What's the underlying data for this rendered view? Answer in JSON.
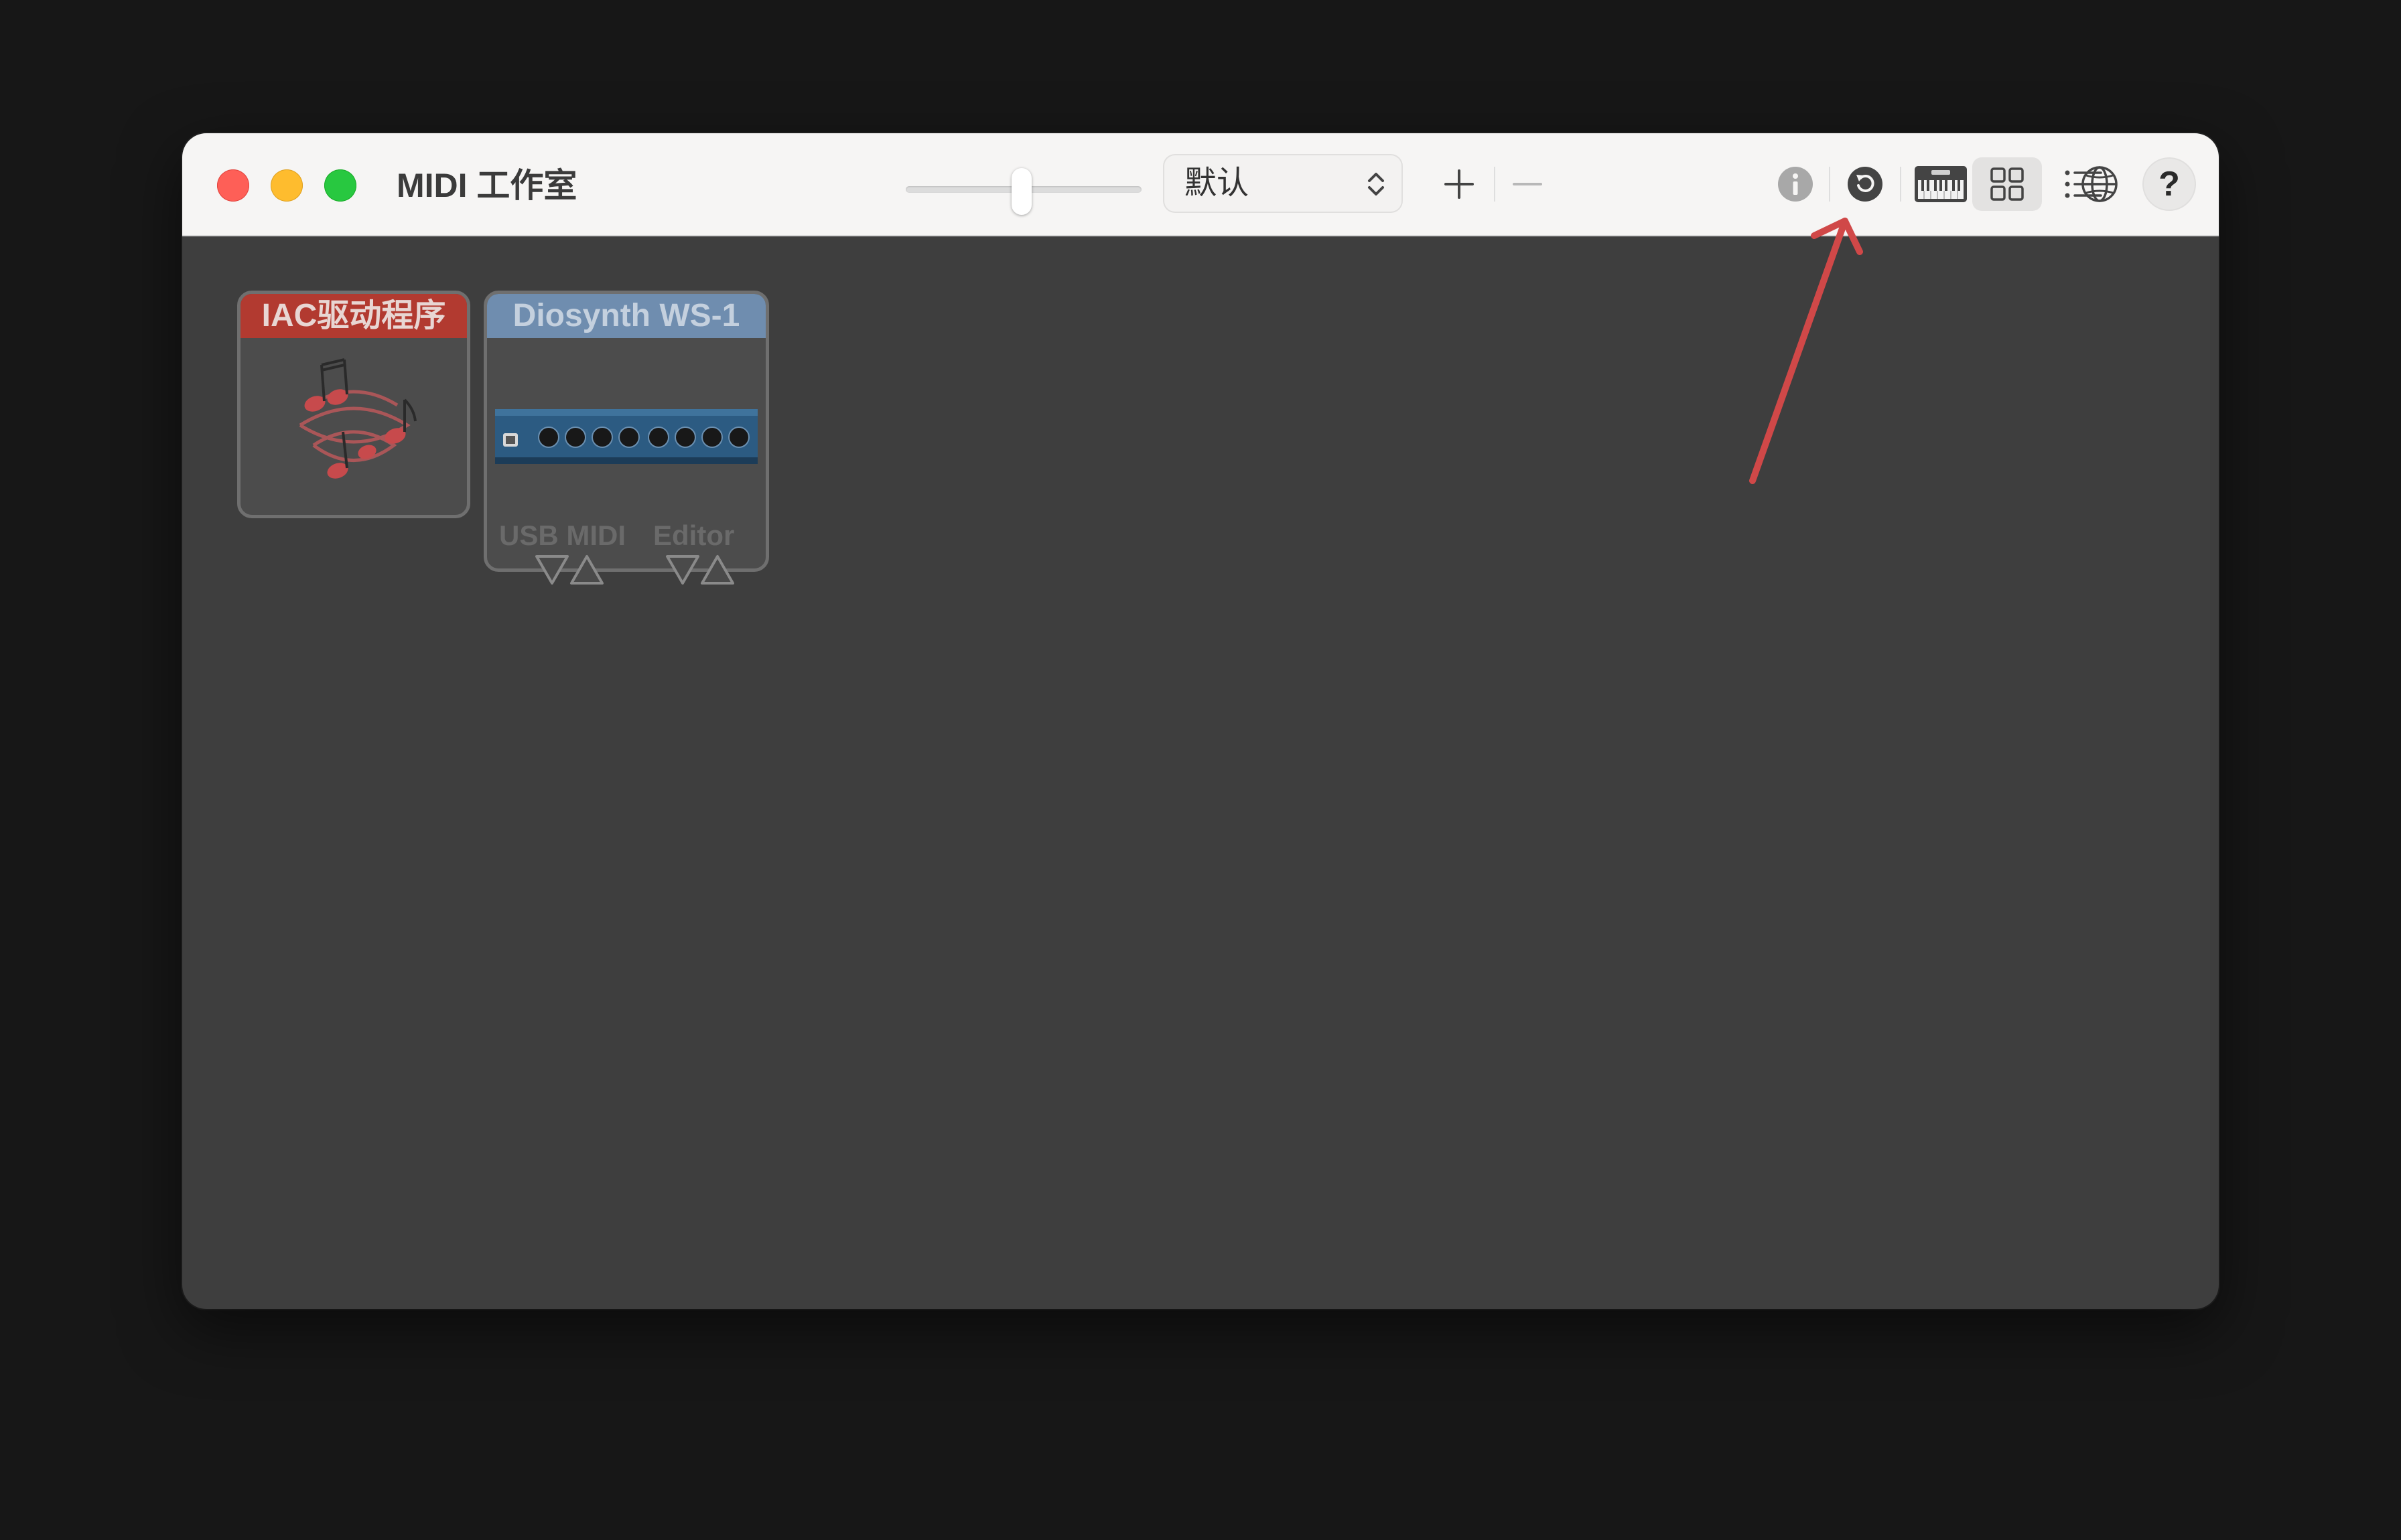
{
  "window": {
    "title": "MIDI 工作室"
  },
  "toolbar": {
    "configuration_select": {
      "value": "默认"
    },
    "icons": [
      "zoom-slider",
      "add-icon",
      "remove-icon",
      "info-icon",
      "rescan-icon",
      "midi-keyboard-icon",
      "bluetooth-icon",
      "network-icon",
      "grid-view-icon",
      "list-view-icon",
      "help-icon"
    ],
    "help_label": "?"
  },
  "devices": [
    {
      "name": "IAC驱动程序",
      "color": "#b23a30",
      "icon": "music-notes-icon"
    },
    {
      "name": "Diosynth WS-1",
      "color": "#6f8daf",
      "icon": "midi-interface-icon",
      "ports": [
        "USB MIDI",
        "Editor"
      ]
    }
  ],
  "colors": {
    "titlebar": "#f6f5f4",
    "canvas": "#3e3e3e",
    "annotation_arrow": "#d04848"
  }
}
